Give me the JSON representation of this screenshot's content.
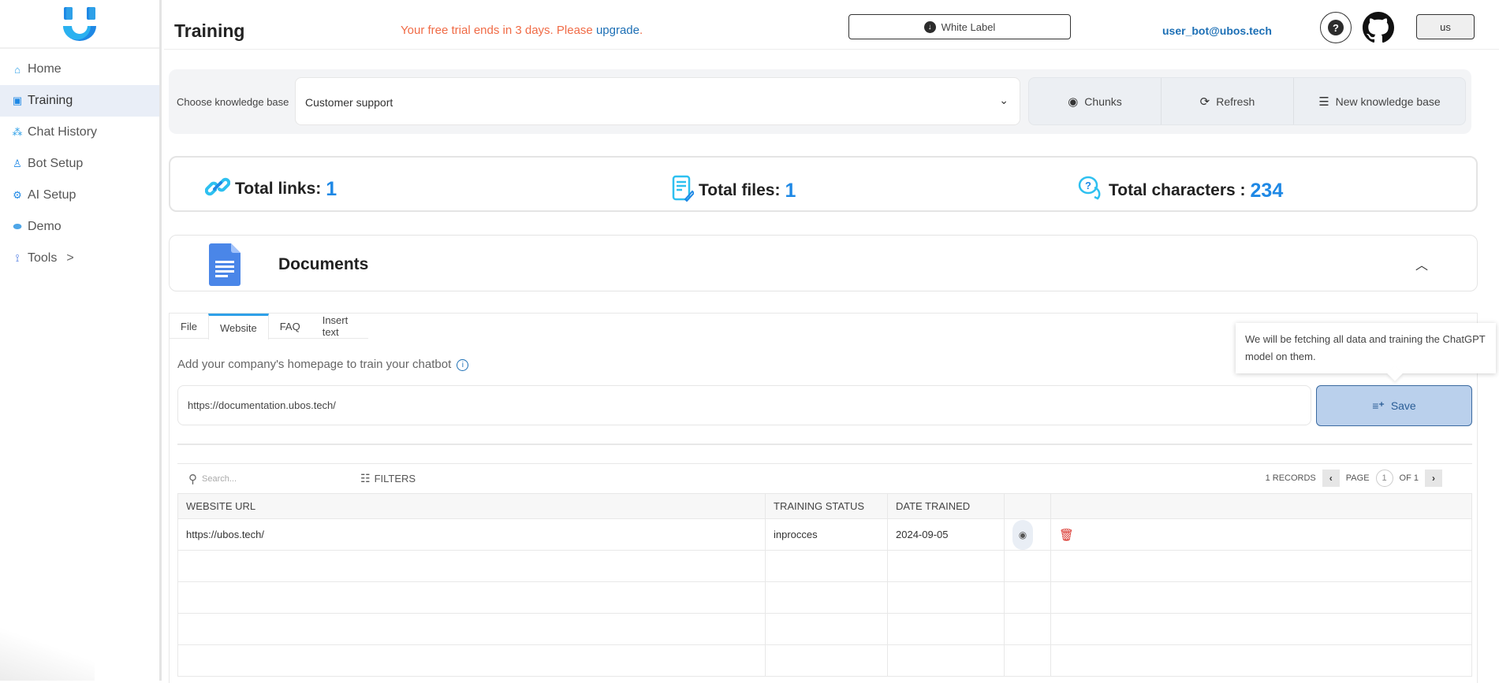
{
  "app": {
    "page_title": "Training"
  },
  "sidebar": {
    "items": [
      {
        "label": "Home",
        "icon": "home-icon"
      },
      {
        "label": "Training",
        "icon": "training-icon",
        "active": true
      },
      {
        "label": "Chat History",
        "icon": "chat-history-icon"
      },
      {
        "label": "Bot Setup",
        "icon": "bot-icon"
      },
      {
        "label": "AI Setup",
        "icon": "gear-icon"
      },
      {
        "label": "Demo",
        "icon": "demo-icon"
      },
      {
        "label": "Tools",
        "icon": "tools-icon",
        "chevron": ">"
      }
    ]
  },
  "topbar": {
    "trial_text": "Your free trial ends in 3 days. Please ",
    "upgrade_link": "upgrade",
    "trial_end": ".",
    "white_label_button": "White Label",
    "user_email": "user_bot@ubos.tech",
    "help_icon": "?",
    "language_button": "us"
  },
  "knowledge_base": {
    "label": "Choose knowledge base",
    "selected": "Customer support",
    "actions": [
      {
        "label": "Chunks",
        "icon": "eye-icon"
      },
      {
        "label": "Refresh",
        "icon": "refresh-icon"
      },
      {
        "label": "New knowledge base",
        "icon": "layers-plus-icon"
      }
    ]
  },
  "stats": {
    "links_label": "Total links:",
    "links_value": "1",
    "files_label": "Total files:",
    "files_value": "1",
    "chars_label": "Total characters :",
    "chars_value": "234"
  },
  "documents": {
    "title": "Documents"
  },
  "tabs": [
    {
      "label": "File"
    },
    {
      "label": "Website",
      "active": true
    },
    {
      "label": "FAQ"
    },
    {
      "label": "Insert text"
    }
  ],
  "website": {
    "hint": "Add your company's homepage to train your chatbot",
    "url_value": "https://documentation.ubos.tech/",
    "save_label": "Save",
    "tooltip": "We will be fetching all data and training the ChatGPT model on them."
  },
  "table": {
    "search_placeholder": "Search...",
    "filters_label": "FILTERS",
    "records": "1 RECORDS",
    "page_label": "PAGE",
    "page_current": "1",
    "page_of": "OF 1",
    "columns": [
      "WEBSITE URL",
      "TRAINING STATUS",
      "DATE TRAINED",
      "",
      ""
    ],
    "rows": [
      {
        "url": "https://ubos.tech/",
        "status": "inprocces",
        "date": "2024-09-05"
      }
    ]
  },
  "colors": {
    "accent": "#1e88e5",
    "trial": "#f06b46",
    "link": "#1c6fb5",
    "delete": "#d9332b",
    "save_bg": "#bad0ec"
  }
}
